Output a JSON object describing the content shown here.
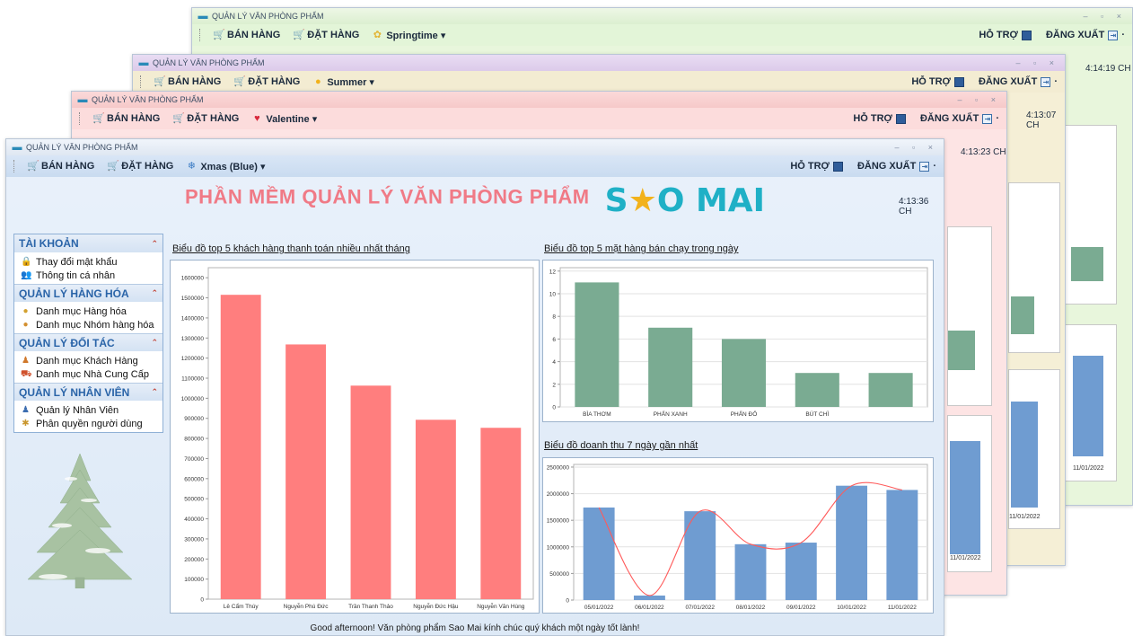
{
  "app": {
    "window_title": "QUẢN LÝ VĂN PHÒNG PHẨM"
  },
  "menu": {
    "ban_hang": "BÁN HÀNG",
    "dat_hang": "ĐẶT HÀNG",
    "ho_tro": "HỖ TRỢ",
    "dang_xuat": "ĐĂNG XUẤT"
  },
  "themes": {
    "spring": "Springtime ▾",
    "summer": "Summer ▾",
    "valentine": "Valentine ▾",
    "xmas": "Xmas (Blue) ▾"
  },
  "clocks": {
    "spring": "4:14:19 CH",
    "summer": "4:13:07 CH",
    "valentine": "4:13:23 CH",
    "main": "4:13:36 CH"
  },
  "ghost_dates": [
    "11/01/2022",
    "11/01/2022",
    "11/01/2022"
  ],
  "brand": {
    "title": "PHẦN MỀM QUẢN LÝ VĂN PHÒNG PHẨM",
    "logo_left": "S",
    "logo_star": "★",
    "logo_right": "O MAI"
  },
  "sidebar": {
    "sections": [
      {
        "title": "TÀI KHOẢN",
        "items": [
          {
            "label": "Thay đổi mật khẩu",
            "icon": "lock-icon",
            "glyph": "🔒",
            "color": "#c9962e"
          },
          {
            "label": "Thông tin cá nhân",
            "icon": "user-card-icon",
            "glyph": "👥",
            "color": "#3c6db0"
          }
        ]
      },
      {
        "title": "QUẢN LÝ HÀNG HÓA",
        "items": [
          {
            "label": "Danh mục Hàng hóa",
            "icon": "goods-icon",
            "glyph": "●",
            "color": "#d3a12f"
          },
          {
            "label": "Danh mục Nhóm hàng hóa",
            "icon": "goods-group-icon",
            "glyph": "●",
            "color": "#d38f2f"
          }
        ]
      },
      {
        "title": "QUẢN LÝ ĐỐI TÁC",
        "items": [
          {
            "label": "Danh mục Khách Hàng",
            "icon": "customer-icon",
            "glyph": "♟",
            "color": "#d0782b"
          },
          {
            "label": "Danh mục Nhà Cung Cấp",
            "icon": "supplier-icon",
            "glyph": "⛟",
            "color": "#d0502b"
          }
        ]
      },
      {
        "title": "QUẢN LÝ NHÂN VIÊN",
        "items": [
          {
            "label": "Quản lý Nhân Viên",
            "icon": "staff-icon",
            "glyph": "♟",
            "color": "#3c6db0"
          },
          {
            "label": "Phân quyền người dùng",
            "icon": "permissions-icon",
            "glyph": "✱",
            "color": "#c9962e"
          }
        ]
      }
    ]
  },
  "footer": "Good afternoon! Văn phòng phẩm Sao Mai kính chúc quý khách một ngày tốt lành!",
  "chart_data": [
    {
      "type": "bar",
      "title": "Biểu đồ top 5 khách hàng thanh toán nhiều nhất tháng",
      "categories": [
        "Lê Cẩm Thúy",
        "Nguyễn Phú Đức",
        "Trần Thanh Thảo",
        "Nguyễn Đức Hậu",
        "Nguyễn Văn Hùng"
      ],
      "values": [
        1515000,
        1268000,
        1063000,
        893000,
        853000
      ],
      "yticks": [
        0,
        100000,
        200000,
        300000,
        400000,
        500000,
        600000,
        700000,
        800000,
        900000,
        1000000,
        1100000,
        1200000,
        1300000,
        1400000,
        1500000,
        1600000
      ],
      "ylim": [
        0,
        1650000
      ],
      "color": "#ff7e7e",
      "grid": false
    },
    {
      "type": "bar",
      "title": "Biểu đồ top 5 mặt hàng bán chạy trong ngày",
      "categories": [
        "BÌA THƠM",
        "PHẤN XANH",
        "PHẤN ĐỎ",
        "BÚT CHÌ",
        ""
      ],
      "values": [
        11,
        7,
        6,
        3,
        3
      ],
      "yticks": [
        0,
        2,
        4,
        6,
        8,
        10,
        12
      ],
      "ylim": [
        0,
        12.3
      ],
      "color": "#7aab92",
      "grid": true
    },
    {
      "type": "bar",
      "title": "Biểu đồ doanh thu 7 ngày gần nhất",
      "categories": [
        "05/01/2022",
        "06/01/2022",
        "07/01/2022",
        "08/01/2022",
        "09/01/2022",
        "10/01/2022",
        "11/01/2022"
      ],
      "values": [
        1740000,
        85000,
        1670000,
        1050000,
        1080000,
        2150000,
        2070000
      ],
      "yticks": [
        0,
        500000,
        1000000,
        1500000,
        2000000,
        2500000
      ],
      "ylim": [
        0,
        2550000
      ],
      "color": "#6f9cd1",
      "trend_line": true,
      "trend_color": "#ff5a5a",
      "grid": true
    }
  ]
}
